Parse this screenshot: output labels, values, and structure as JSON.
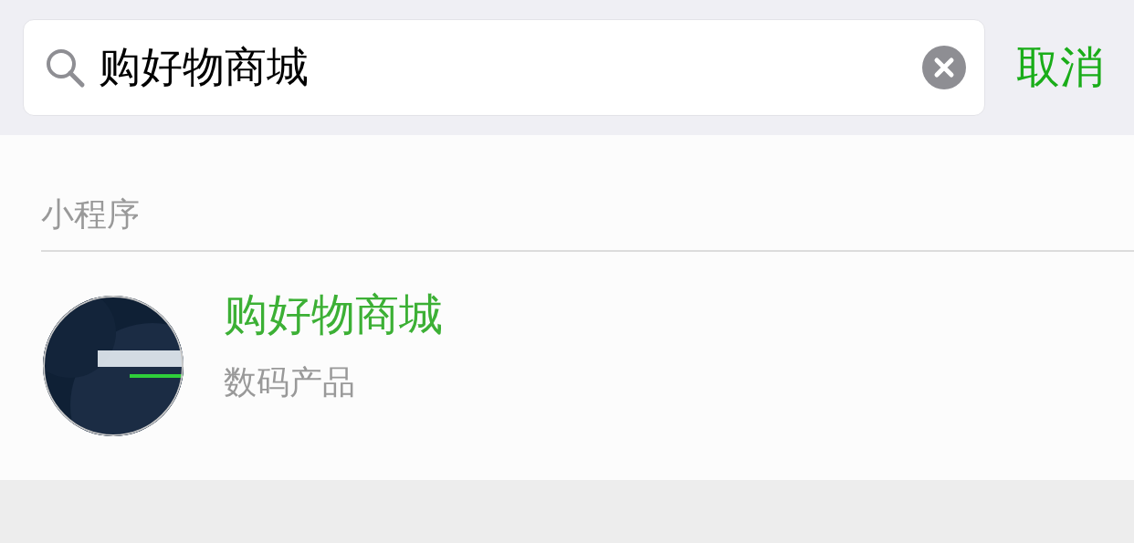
{
  "search": {
    "value": "购好物商城",
    "cancel": "取消"
  },
  "section": {
    "title": "小程序",
    "results": [
      {
        "title": "购好物商城",
        "subtitle": "数码产品"
      }
    ]
  }
}
